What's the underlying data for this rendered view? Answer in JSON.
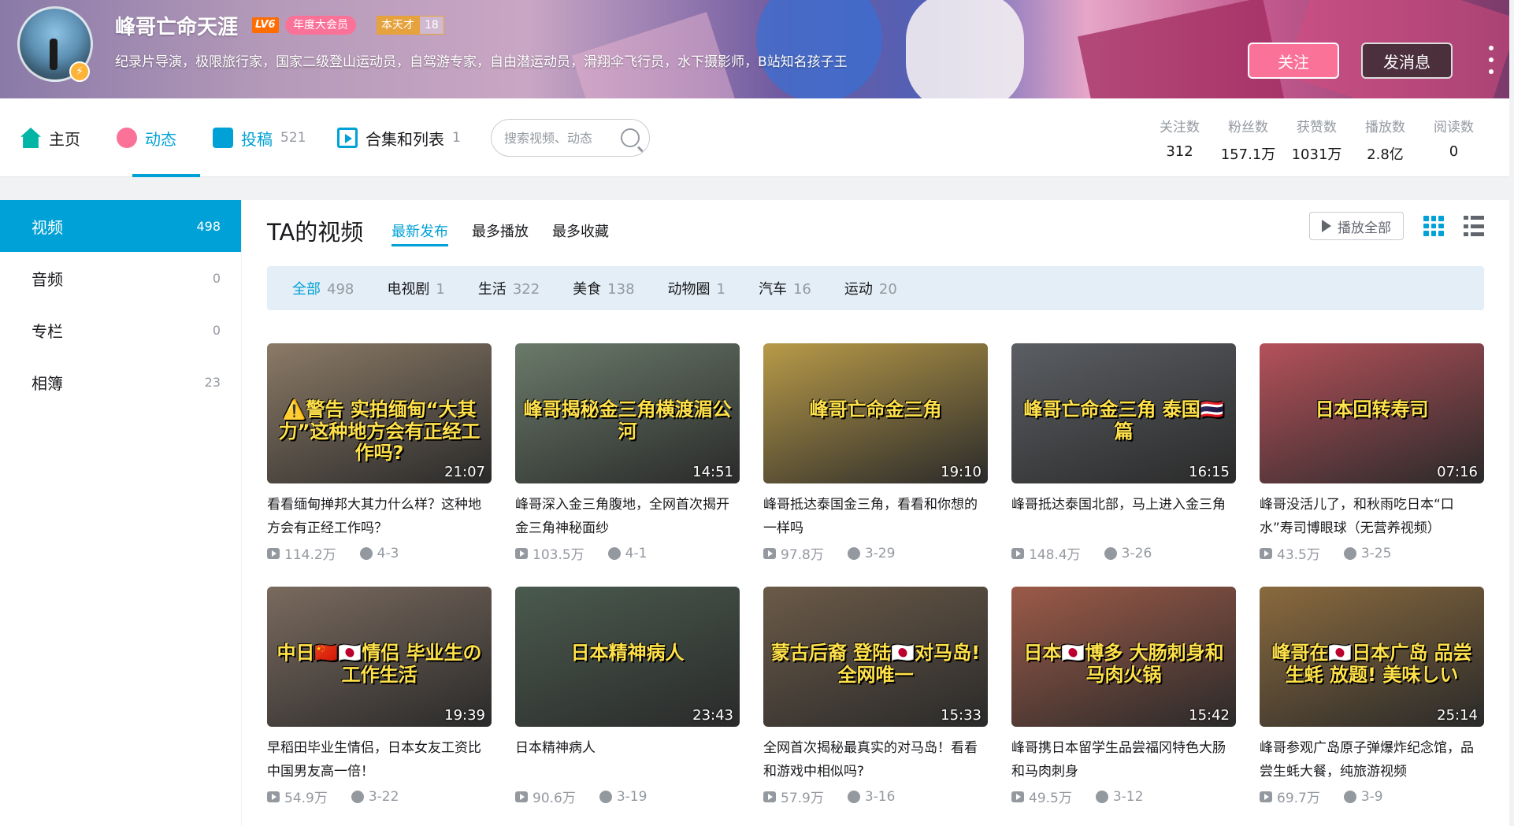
{
  "profile": {
    "username": "峰哥亡命天涯",
    "level": "LV6",
    "vip": "年度大会员",
    "tag_name": "本天才",
    "tag_num": "18",
    "sign": "纪录片导演，极限旅行家，国家二级登山运动员，自驾游专家，自由潜运动员，滑翔伞飞行员，水下摄影师，B站知名孩子王",
    "follow_btn": "关注",
    "message_btn": "发消息"
  },
  "nav": {
    "home": "主页",
    "dynamic": "动态",
    "posts": "投稿",
    "posts_count": "521",
    "collections": "合集和列表",
    "collections_count": "1",
    "search_placeholder": "搜索视频、动态"
  },
  "stats": [
    {
      "label": "关注数",
      "value": "312"
    },
    {
      "label": "粉丝数",
      "value": "157.1万"
    },
    {
      "label": "获赞数",
      "value": "1031万"
    },
    {
      "label": "播放数",
      "value": "2.8亿"
    },
    {
      "label": "阅读数",
      "value": "0"
    }
  ],
  "sidebar": [
    {
      "label": "视频",
      "count": "498"
    },
    {
      "label": "音频",
      "count": "0"
    },
    {
      "label": "专栏",
      "count": "0"
    },
    {
      "label": "相簿",
      "count": "23"
    }
  ],
  "main": {
    "title": "TA的视频",
    "sort_tabs": [
      "最新发布",
      "最多播放",
      "最多收藏"
    ],
    "play_all": "播放全部",
    "filters": [
      {
        "label": "全部",
        "count": "498"
      },
      {
        "label": "电视剧",
        "count": "1"
      },
      {
        "label": "生活",
        "count": "322"
      },
      {
        "label": "美食",
        "count": "138"
      },
      {
        "label": "动物圈",
        "count": "1"
      },
      {
        "label": "汽车",
        "count": "16"
      },
      {
        "label": "运动",
        "count": "20"
      }
    ]
  },
  "videos": [
    {
      "thumb_text": "⚠️警告 实拍缅甸“大其力”这种地方会有正经工作吗?",
      "duration": "21:07",
      "title": "看看缅甸掸邦大其力什么样？这种地方会有正经工作吗？",
      "views": "114.2万",
      "date": "4-3",
      "color": "#8b7a66"
    },
    {
      "thumb_text": "峰哥揭秘金三角横渡湄公河",
      "duration": "14:51",
      "title": "峰哥深入金三角腹地，全网首次揭开金三角神秘面纱",
      "views": "103.5万",
      "date": "4-1",
      "color": "#6a7a6a"
    },
    {
      "thumb_text": "峰哥亡命金三角",
      "duration": "19:10",
      "title": "峰哥抵达泰国金三角，看看和你想的一样吗",
      "views": "97.8万",
      "date": "3-29",
      "color": "#b89a48"
    },
    {
      "thumb_text": "峰哥亡命金三角 泰国🇹🇭篇",
      "duration": "16:15",
      "title": "峰哥抵达泰国北部，马上进入金三角",
      "views": "148.4万",
      "date": "3-26",
      "color": "#5b5e63"
    },
    {
      "thumb_text": "日本回转寿司",
      "duration": "07:16",
      "title": "峰哥没活儿了，和秋雨吃日本“口水”寿司博眼球（无营养视频）",
      "views": "43.5万",
      "date": "3-25",
      "color": "#b5515a"
    },
    {
      "thumb_text": "中日🇨🇳🇯🇵情侣 毕业生の工作生活",
      "duration": "19:39",
      "title": "早稻田毕业生情侣，日本女友工资比中国男友高一倍！",
      "views": "54.9万",
      "date": "3-22",
      "color": "#7a6a5e"
    },
    {
      "thumb_text": "日本精神病人",
      "duration": "23:43",
      "title": "日本精神病人",
      "views": "90.6万",
      "date": "3-19",
      "color": "#4a5a4e"
    },
    {
      "thumb_text": "蒙古后裔 登陆🇯🇵对马岛! 全网唯一",
      "duration": "15:33",
      "title": "全网首次揭秘最真实的对马岛！看看和游戏中相似吗?",
      "views": "57.9万",
      "date": "3-16",
      "color": "#6b5a48"
    },
    {
      "thumb_text": "日本🇯🇵博多 大肠刺身和马肉火锅",
      "duration": "15:42",
      "title": "峰哥携日本留学生品尝福冈特色大肠和马肉刺身",
      "views": "49.5万",
      "date": "3-12",
      "color": "#9c5a48"
    },
    {
      "thumb_text": "峰哥在🇯🇵日本广岛 品尝生蚝 放题! 美味しい",
      "duration": "25:14",
      "title": "峰哥参观广岛原子弹爆炸纪念馆，品尝生蚝大餐，纯旅游视频",
      "views": "69.7万",
      "date": "3-9",
      "color": "#8a6a3e"
    }
  ]
}
